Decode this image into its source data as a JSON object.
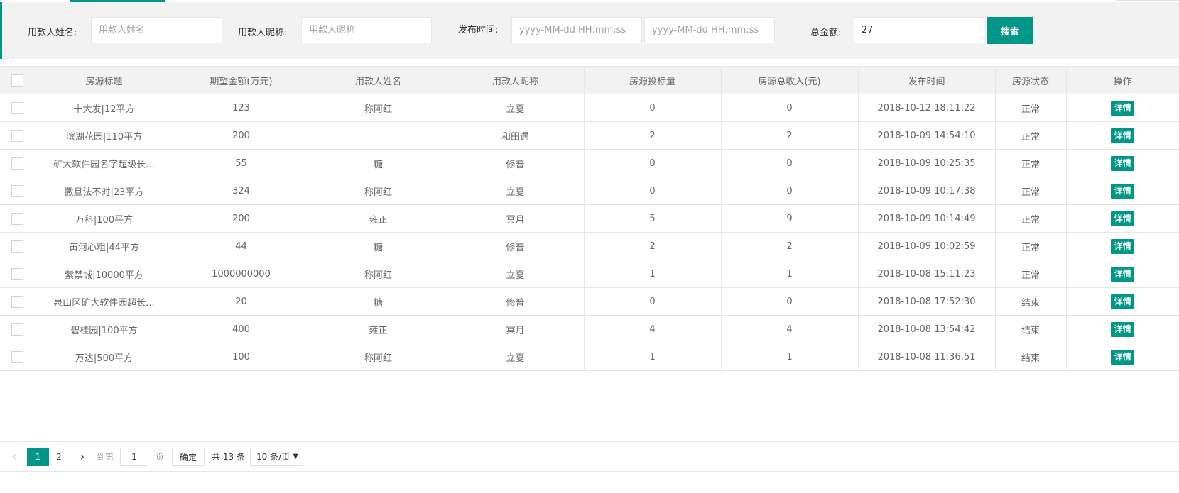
{
  "search": {
    "borrower_name_label": "用款人姓名:",
    "borrower_name_placeholder": "用款人姓名",
    "borrower_nick_label": "用款人昵称:",
    "borrower_nick_placeholder": "用款人昵称",
    "publish_time_label": "发布时间:",
    "time_start_placeholder": "yyyy-MM-dd HH:mm:ss",
    "time_end_placeholder": "yyyy-MM-dd HH:mm:ss",
    "total_amount_label": "总金额:",
    "total_amount_value": "27",
    "search_button": "搜索"
  },
  "table": {
    "columns": [
      "房源标题",
      "期望金额(万元)",
      "用款人姓名",
      "用款人昵称",
      "房源投标量",
      "房源总收入(元)",
      "发布时间",
      "房源状态",
      "操作"
    ],
    "detail_label": "详情",
    "rows": [
      {
        "title": "十大发|12平方",
        "amount": "123",
        "name": "称阿红",
        "nick": "立夏",
        "bids": "0",
        "income": "0",
        "time": "2018-10-12 18:11:22",
        "status": "正常"
      },
      {
        "title": "滨湖花园|110平方",
        "amount": "200",
        "name": "",
        "nick": "和田遇",
        "bids": "2",
        "income": "2",
        "time": "2018-10-09 14:54:10",
        "status": "正常"
      },
      {
        "title": "矿大软件园名字超级长...",
        "amount": "55",
        "name": "糖",
        "nick": "修普",
        "bids": "0",
        "income": "0",
        "time": "2018-10-09 10:25:35",
        "status": "正常"
      },
      {
        "title": "撒旦法不对|23平方",
        "amount": "324",
        "name": "称阿红",
        "nick": "立夏",
        "bids": "0",
        "income": "0",
        "time": "2018-10-09 10:17:38",
        "status": "正常"
      },
      {
        "title": "万科|100平方",
        "amount": "200",
        "name": "雍正",
        "nick": "冥月",
        "bids": "5",
        "income": "9",
        "time": "2018-10-09 10:14:49",
        "status": "正常"
      },
      {
        "title": "黄河心粗|44平方",
        "amount": "44",
        "name": "糖",
        "nick": "修普",
        "bids": "2",
        "income": "2",
        "time": "2018-10-09 10:02:59",
        "status": "正常"
      },
      {
        "title": "紫禁城|10000平方",
        "amount": "1000000000",
        "name": "称阿红",
        "nick": "立夏",
        "bids": "1",
        "income": "1",
        "time": "2018-10-08 15:11:23",
        "status": "正常"
      },
      {
        "title": "泉山区矿大软件园超长...",
        "amount": "20",
        "name": "糖",
        "nick": "修普",
        "bids": "0",
        "income": "0",
        "time": "2018-10-08 17:52:30",
        "status": "结束"
      },
      {
        "title": "碧桂园|100平方",
        "amount": "400",
        "name": "雍正",
        "nick": "冥月",
        "bids": "4",
        "income": "4",
        "time": "2018-10-08 13:54:42",
        "status": "结束"
      },
      {
        "title": "万达|500平方",
        "amount": "100",
        "name": "称阿红",
        "nick": "立夏",
        "bids": "1",
        "income": "1",
        "time": "2018-10-08 11:36:51",
        "status": "结束"
      }
    ]
  },
  "pager": {
    "prev_icon": "‹",
    "current_page": "1",
    "page_2": "2",
    "next_icon": "›",
    "goto_label": "到第",
    "goto_value": "1",
    "page_unit": "页",
    "confirm": "确定",
    "total": "共 13 条",
    "page_size": "10 条/页"
  },
  "colors": {
    "accent": "#009688",
    "header_bg": "#f2f2f2",
    "border": "#e6e6e6"
  }
}
